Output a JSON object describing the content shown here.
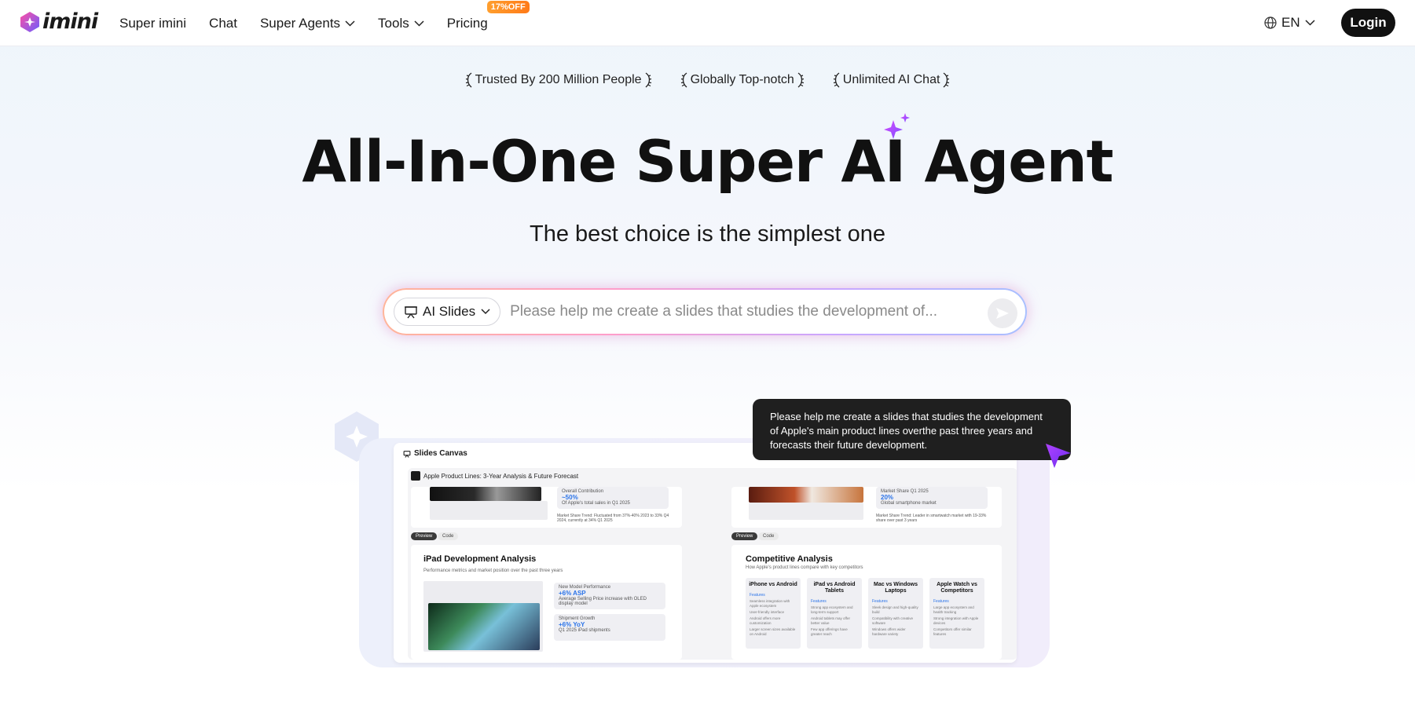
{
  "nav": {
    "logo_text": "imini",
    "items": [
      {
        "label": "Super imini",
        "has_dropdown": false
      },
      {
        "label": "Chat",
        "has_dropdown": false
      },
      {
        "label": "Super Agents",
        "has_dropdown": true
      },
      {
        "label": "Tools",
        "has_dropdown": true
      },
      {
        "label": "Pricing",
        "has_dropdown": false
      }
    ],
    "pricing_badge": "17%OFF",
    "language": "EN",
    "login_label": "Login"
  },
  "badges": [
    "Trusted By 200 Million People",
    "Globally Top-notch",
    "Unlimited AI Chat"
  ],
  "hero": {
    "title": "All-In-One Super AI Agent",
    "subtitle": "The best choice is the simplest one"
  },
  "search": {
    "mode_label": "AI Slides",
    "placeholder": "Please help me create a slides that studies the development of..."
  },
  "preview": {
    "canvas_title": "Slides Canvas",
    "doc_title": "Apple Product Lines: 3-Year Analysis & Future Forecast",
    "top_left": {
      "stat_label": "Overall Contribution",
      "stat_value": "~50%",
      "stat_note": "Of Apple's total sales in Q1 2025",
      "trend_text": "Market Share Trend: Fluctuated from 37%-40% 2023 to 33% Q4 2024, currently at 34% Q1 2025"
    },
    "top_right": {
      "stat_label": "Market Share Q1 2025",
      "stat_value": "20%",
      "stat_note": "Global smartphone market",
      "trend_text": "Market Share Trend: Leader in smartwatch market with 19-33% share over past 3 years"
    },
    "tabs": [
      "Preview",
      "Code"
    ],
    "ipad": {
      "title": "iPad Development Analysis",
      "subtitle": "Performance metrics and market position over the past three years",
      "stats": [
        {
          "label": "New Model Performance",
          "value": "+6% ASP",
          "note": "Average Selling Price increase with OLED display model"
        },
        {
          "label": "Shipment Growth",
          "value": "+6% YoY",
          "note": "Q1 2025 iPad shipments"
        }
      ]
    },
    "competitive": {
      "title": "Competitive Analysis",
      "subtitle": "How Apple's product lines compare with key competitors",
      "features_label": "Features",
      "columns": [
        {
          "title": "iPhone vs Android",
          "lines": [
            "Seamless integration with Apple ecosystem",
            "User-friendly interface",
            "Android offers more customization",
            "Larger screen sizes available on Android"
          ]
        },
        {
          "title": "iPad vs Android Tablets",
          "lines": [
            "Strong app ecosystem and long-term support",
            "Android tablets may offer better value",
            "Few app offerings have greater reach"
          ]
        },
        {
          "title": "Mac vs Windows Laptops",
          "lines": [
            "Sleek design and high-quality build",
            "Compatibility with creative software",
            "Windows offers wider hardware variety"
          ]
        },
        {
          "title": "Apple Watch vs Competitors",
          "lines": [
            "Large app ecosystem and health tracking",
            "Strong integration with Apple devices",
            "Competitors offer similar features"
          ]
        }
      ]
    }
  },
  "tooltip": {
    "text": "Please help me create a slides that studies the development of Apple's main product lines overthe past three years and forecasts their future development."
  },
  "colors": {
    "accent_purple": "#9b4dff",
    "badge_orange": "#ff8a1f",
    "login_bg": "#111111"
  }
}
